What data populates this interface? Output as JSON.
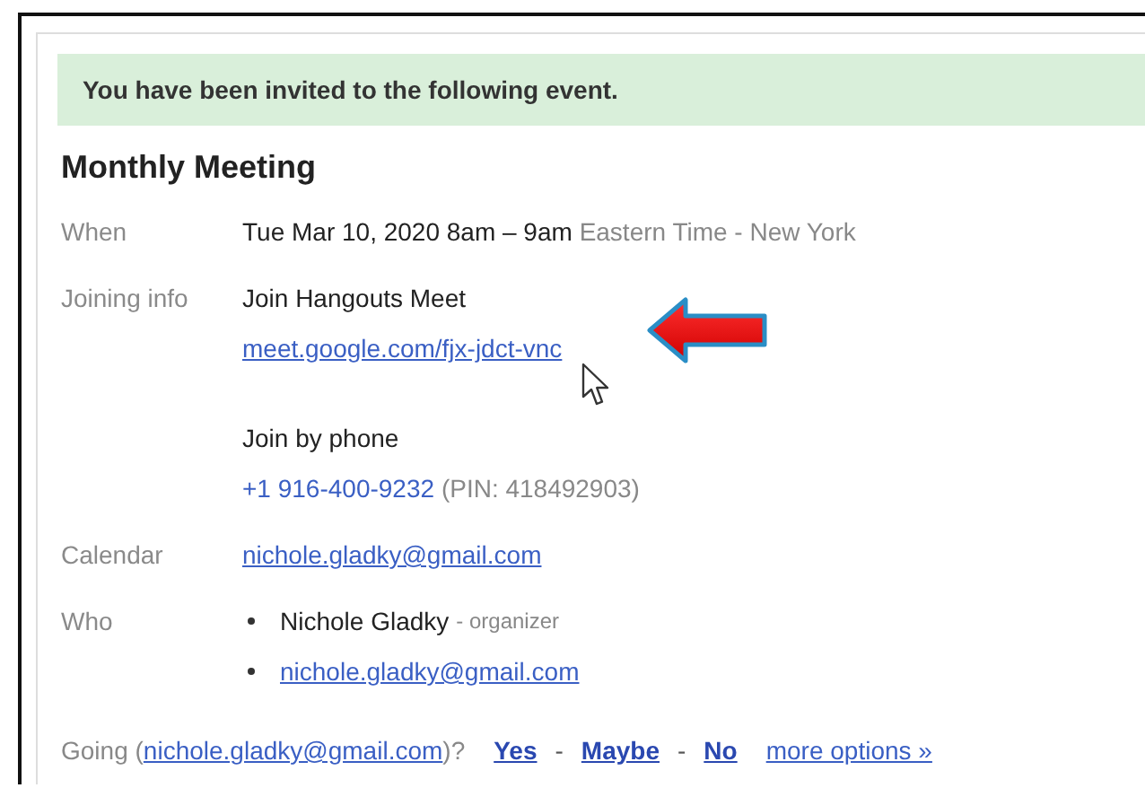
{
  "banner": "You have been invited to the following event.",
  "event": {
    "title": "Monthly Meeting",
    "when": {
      "label": "When",
      "time": "Tue Mar 10, 2020 8am – 9am",
      "timezone": "Eastern Time - New York"
    },
    "joining_info": {
      "label": "Joining info",
      "video_heading": "Join Hangouts Meet",
      "video_link": "meet.google.com/fjx-jdct-vnc",
      "phone_heading": "Join by phone",
      "phone": "+1 916-400-9232",
      "pin": "(PIN: 418492903)"
    },
    "calendar": {
      "label": "Calendar",
      "value": "nichole.gladky@gmail.com"
    },
    "who": {
      "label": "Who",
      "guests": [
        {
          "kind": "person",
          "name": "Nichole Gladky",
          "role": "- organizer"
        },
        {
          "kind": "email",
          "email": "nichole.gladky@gmail.com"
        }
      ]
    }
  },
  "rsvp": {
    "prompt_start": "Going (",
    "email": "nichole.gladky@gmail.com",
    "prompt_end": ")?",
    "options": [
      {
        "label": "Yes"
      },
      {
        "label": "Maybe"
      },
      {
        "label": "No"
      }
    ],
    "separators": [
      "-",
      "-"
    ],
    "more": "more options »"
  }
}
